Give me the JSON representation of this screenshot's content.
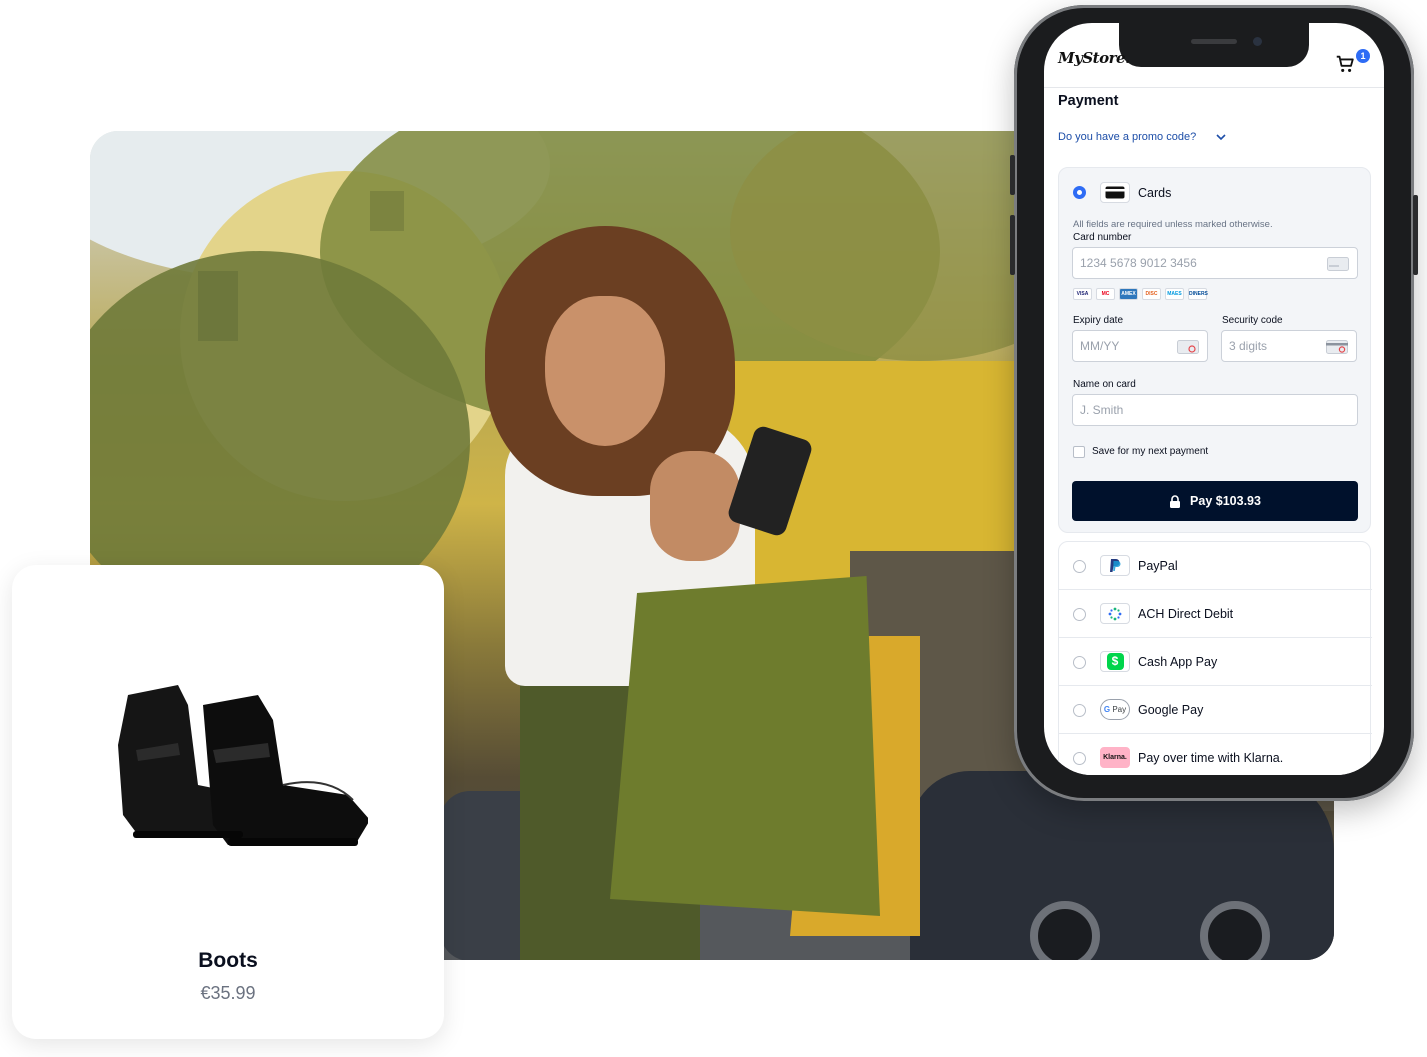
{
  "product": {
    "name": "Boots",
    "price": "€35.99"
  },
  "app": {
    "logo": "MyStore.",
    "cart_count": "1"
  },
  "payment": {
    "title": "Payment",
    "promo_link": "Do you have a promo code?",
    "cards": {
      "label": "Cards",
      "required_hint": "All fields are required unless marked otherwise.",
      "card_number_label": "Card number",
      "card_number_placeholder": "1234 5678 9012 3456",
      "brands": [
        "VISA",
        "MC",
        "AMEX",
        "DISC",
        "MAES",
        "DINERS"
      ],
      "expiry_label": "Expiry date",
      "expiry_placeholder": "MM/YY",
      "security_label": "Security code",
      "security_placeholder": "3 digits",
      "name_label": "Name on card",
      "name_placeholder": "J. Smith",
      "save_label": "Save for my next payment",
      "pay_button": "Pay $103.93"
    },
    "methods": [
      {
        "label": "PayPal",
        "icon": "paypal-icon"
      },
      {
        "label": "ACH Direct Debit",
        "icon": "ach-icon"
      },
      {
        "label": "Cash App Pay",
        "icon": "cash-app-icon"
      },
      {
        "label": "Google Pay",
        "icon": "google-pay-icon"
      },
      {
        "label": "Pay over time with Klarna.",
        "icon": "klarna-icon"
      }
    ]
  },
  "colors": {
    "accent": "#2e6cf5",
    "pay_button": "#00112c",
    "link": "#1d4ea8"
  }
}
